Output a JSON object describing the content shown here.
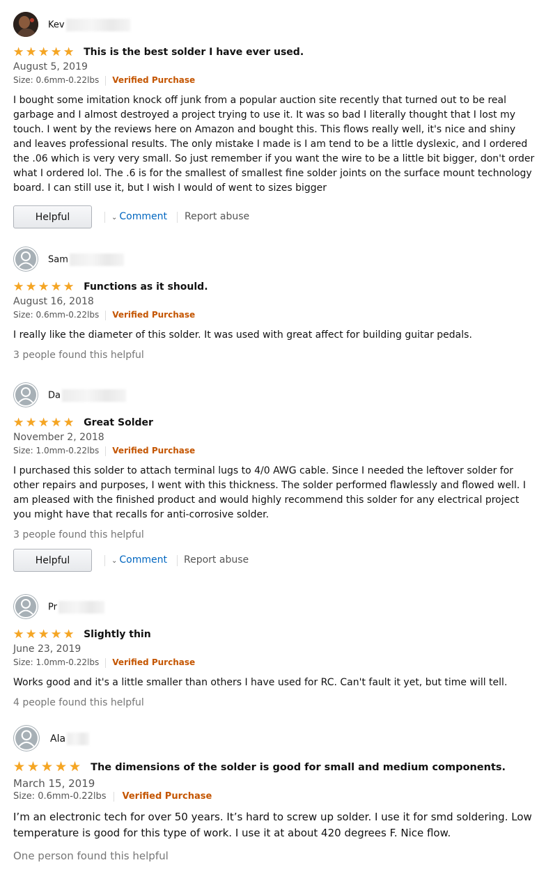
{
  "reviews": [
    {
      "reviewer": "Kev",
      "avatar": "photo-avatar",
      "rating": 5,
      "title": "This is the best solder I have ever used.",
      "date": "August 5, 2019",
      "size": "Size: 0.6mm-0.22lbs",
      "verified": "Verified Purchase",
      "body": "I bought some imitation knock off junk from a popular auction site recently that turned out to be real garbage and I almost destroyed a project trying to use it. It was so bad I literally thought that I lost my touch. I went by the reviews here on Amazon and bought this. This flows really well, it's nice and shiny and leaves professional results. The only mistake I made is I am tend to be a little dyslexic, and I ordered the .06 which is very very small. So just remember if you want the wire to be a little bit bigger, don't order what I ordered lol. The .6 is for the smallest of smallest fine solder joints on the surface mount technology board. I can still use it, but I wish I would of went to sizes bigger",
      "helpful_text": "",
      "helpful_label": "Helpful",
      "comment_label": "Comment",
      "report_label": "Report abuse"
    },
    {
      "reviewer": "Sam",
      "avatar": "default-avatar",
      "rating": 5,
      "title": "Functions as it should.",
      "date": "August 16, 2018",
      "size": "Size: 0.6mm-0.22lbs",
      "verified": "Verified Purchase",
      "body": "I really like the diameter of this solder. It was used with great affect for building guitar pedals.",
      "helpful_text": "3 people found this helpful"
    },
    {
      "reviewer": "Da",
      "avatar": "default-avatar",
      "rating": 5,
      "title": "Great Solder",
      "date": "November 2, 2018",
      "size": "Size: 1.0mm-0.22lbs",
      "verified": "Verified Purchase",
      "body": "I purchased this solder to attach terminal lugs to 4/0 AWG cable. Since I needed the leftover solder for other repairs and purposes, I went with this thickness. The solder performed flawlessly and flowed well. I am pleased with the finished product and would highly recommend this solder for any electrical project you might have that recalls for anti-corrosive solder.",
      "helpful_text": "3 people found this helpful",
      "helpful_label": "Helpful",
      "comment_label": "Comment",
      "report_label": "Report abuse"
    },
    {
      "reviewer": "Pr",
      "avatar": "default-avatar",
      "rating": 5,
      "title": "Slightly thin",
      "date": "June 23, 2019",
      "size": "Size: 1.0mm-0.22lbs",
      "verified": "Verified Purchase",
      "body": "Works good and it's a little smaller than others I have used for RC. Can't fault it yet, but time will tell.",
      "helpful_text": "4 people found this helpful"
    },
    {
      "reviewer": "Ala",
      "avatar": "default-avatar",
      "rating": 5,
      "title": "The dimensions of the solder is good for small and medium components.",
      "date": "March 15, 2019",
      "size": "Size: 0.6mm-0.22lbs",
      "verified": "Verified Purchase",
      "body": "I’m an electronic tech for over 50 years. It’s hard to screw up solder. I use it for smd soldering. Low temperature is good for this type of work. I use it at about 420 degrees F. Nice flow.",
      "helpful_text": "One person found this helpful"
    }
  ],
  "colors": {
    "star": "#f5a623",
    "verified": "#c45500",
    "link": "#0066c0"
  }
}
